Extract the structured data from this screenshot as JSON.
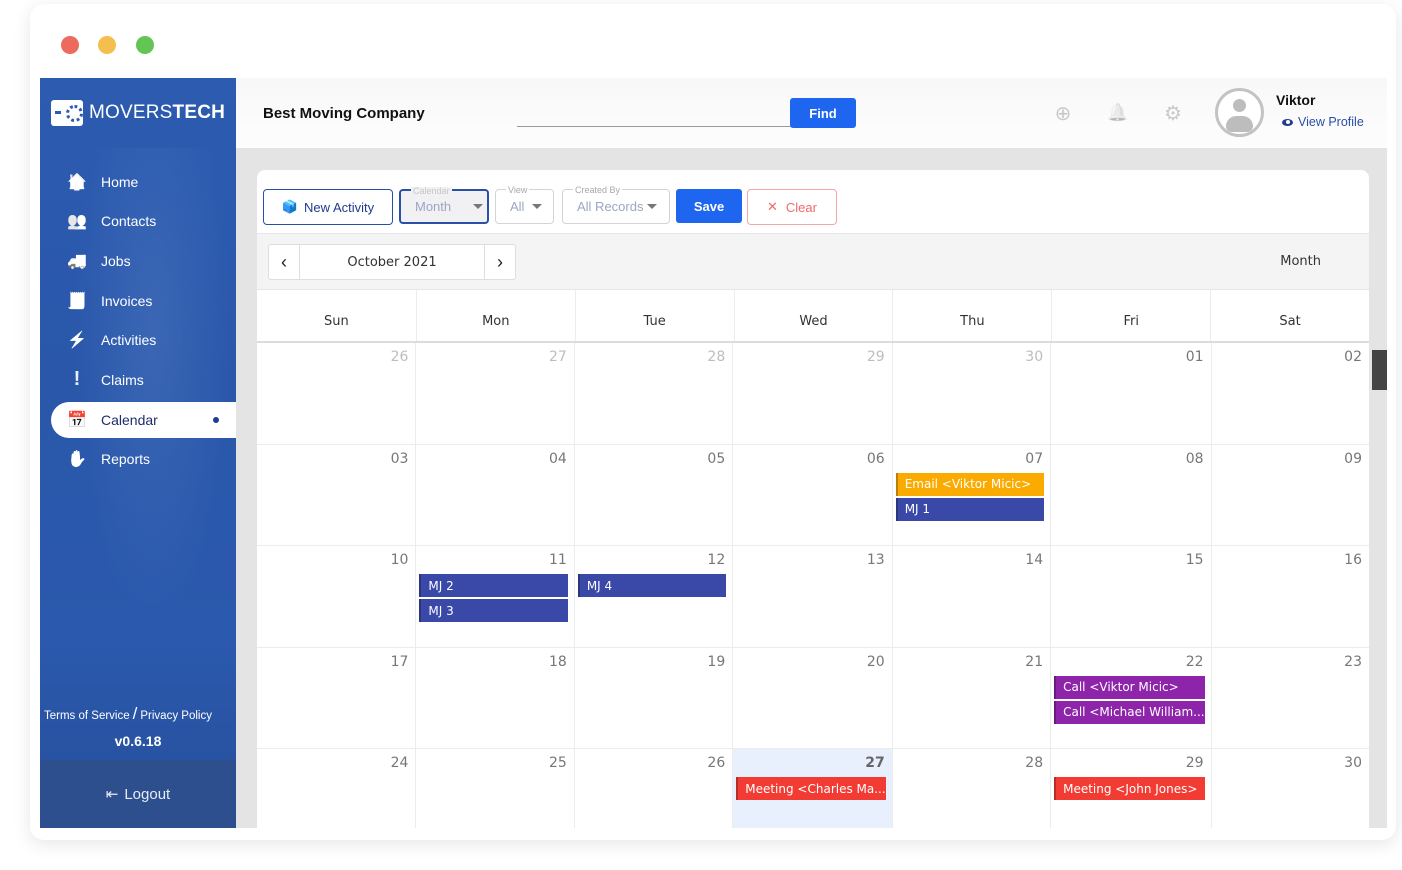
{
  "window": {
    "traffic_lights": [
      "close",
      "minimize",
      "maximize"
    ]
  },
  "sidebar": {
    "logo": {
      "light": "MOVERS",
      "bold": "TECH"
    },
    "items": [
      {
        "label": "Home",
        "icon": "home-truck-icon",
        "glyph": "🏠"
      },
      {
        "label": "Contacts",
        "icon": "contacts-icon",
        "glyph": "👥"
      },
      {
        "label": "Jobs",
        "icon": "truck-icon",
        "glyph": "🚚"
      },
      {
        "label": "Invoices",
        "icon": "invoice-icon",
        "glyph": "🧾"
      },
      {
        "label": "Activities",
        "icon": "activities-icon",
        "glyph": "⚡"
      },
      {
        "label": "Claims",
        "icon": "exclamation-icon",
        "glyph": "!"
      },
      {
        "label": "Calendar",
        "icon": "calendar-icon",
        "glyph": "📅",
        "active": true
      },
      {
        "label": "Reports",
        "icon": "hand-icon",
        "glyph": "✋"
      }
    ],
    "terms": "Terms of Service",
    "separator": "/",
    "privacy": "Privacy Policy",
    "version": "v0.6.18",
    "logout": "Logout",
    "logout_glyph": "⇤"
  },
  "header": {
    "company": "Best Moving Company",
    "search_value": "",
    "find": "Find",
    "add_glyph": "⊕",
    "bell_glyph": "🔔",
    "gear_glyph": "⚙",
    "user_name": "Viktor",
    "view_profile": "View Profile"
  },
  "toolbar": {
    "new_activity": "New Activity",
    "new_activity_glyph": "📦",
    "calendar_label": "Calendar",
    "calendar_value": "Month",
    "view_label": "View",
    "view_value": "All",
    "created_by_label": "Created By",
    "created_by_value": "All Records",
    "save": "Save",
    "clear": "Clear",
    "clear_glyph": "✕"
  },
  "calendar": {
    "month_label": "October 2021",
    "prev_glyph": "‹",
    "next_glyph": "›",
    "view_name": "Month",
    "weekdays": [
      "Sun",
      "Mon",
      "Tue",
      "Wed",
      "Thu",
      "Fri",
      "Sat"
    ],
    "colors": {
      "email": "#fbaa00",
      "job": "#3a48a8",
      "call": "#8e24aa",
      "meeting": "#f23c33"
    },
    "weeks": [
      [
        {
          "n": "26",
          "other": true
        },
        {
          "n": "27",
          "other": true
        },
        {
          "n": "28",
          "other": true
        },
        {
          "n": "29",
          "other": true
        },
        {
          "n": "30",
          "other": true
        },
        {
          "n": "01"
        },
        {
          "n": "02"
        }
      ],
      [
        {
          "n": "03"
        },
        {
          "n": "04"
        },
        {
          "n": "05"
        },
        {
          "n": "06"
        },
        {
          "n": "07",
          "events": [
            {
              "title": "Email <Viktor Micic>",
              "type": "email"
            },
            {
              "title": "MJ 1",
              "type": "job"
            }
          ]
        },
        {
          "n": "08"
        },
        {
          "n": "09"
        }
      ],
      [
        {
          "n": "10"
        },
        {
          "n": "11",
          "events": [
            {
              "title": "MJ 2",
              "type": "job"
            },
            {
              "title": "MJ 3",
              "type": "job"
            }
          ]
        },
        {
          "n": "12",
          "events": [
            {
              "title": "MJ 4",
              "type": "job"
            }
          ]
        },
        {
          "n": "13"
        },
        {
          "n": "14"
        },
        {
          "n": "15"
        },
        {
          "n": "16"
        }
      ],
      [
        {
          "n": "17"
        },
        {
          "n": "18"
        },
        {
          "n": "19"
        },
        {
          "n": "20"
        },
        {
          "n": "21"
        },
        {
          "n": "22",
          "events": [
            {
              "title": "Call <Viktor Micic>",
              "type": "call"
            },
            {
              "title": "Call <Michael William...",
              "type": "call"
            }
          ]
        },
        {
          "n": "23"
        }
      ],
      [
        {
          "n": "24"
        },
        {
          "n": "25"
        },
        {
          "n": "26"
        },
        {
          "n": "27",
          "today": true,
          "events": [
            {
              "title": "Meeting <Charles Ma...",
              "type": "meeting"
            }
          ]
        },
        {
          "n": "28"
        },
        {
          "n": "29",
          "events": [
            {
              "title": "Meeting <John Jones>",
              "type": "meeting"
            }
          ]
        },
        {
          "n": "30"
        }
      ]
    ]
  }
}
